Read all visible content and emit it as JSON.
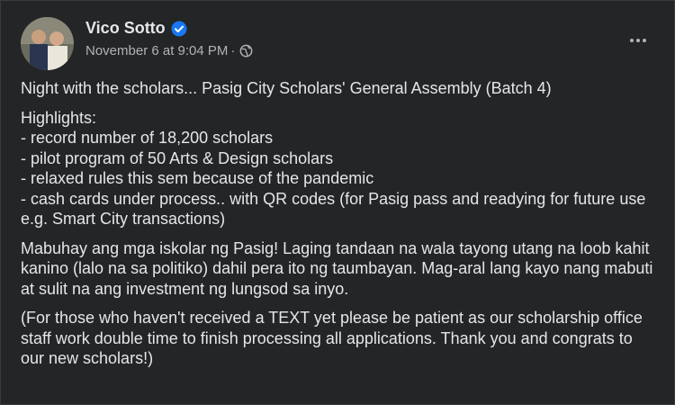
{
  "post": {
    "author": "Vico Sotto",
    "timestamp": "November 6 at 9:04 PM",
    "separator": "·",
    "verified_icon": "verified-badge-icon",
    "privacy_icon": "globe-icon",
    "more_icon": "more-options-icon",
    "colors": {
      "background": "#242526",
      "text": "#e4e6eb",
      "secondary_text": "#b0b3b8",
      "verified": "#1877f2"
    },
    "paragraphs": [
      "Night with the scholars... Pasig City Scholars' General Assembly (Batch 4)",
      "Highlights:\n- record number of 18,200 scholars\n- pilot program of 50 Arts & Design scholars\n- relaxed rules this sem because of the pandemic\n- cash cards under process.. with QR codes (for Pasig pass and readying for future use e.g. Smart City transactions)",
      "Mabuhay ang mga iskolar ng Pasig! Laging tandaan na wala tayong utang na loob kahit kanino (lalo na sa politiko) dahil pera ito ng taumbayan. Mag-aral lang kayo nang mabuti at sulit na ang investment ng lungsod sa inyo.",
      "(For those who haven't received a TEXT yet please be patient as our scholarship office staff work double time to finish processing all applications. Thank you and congrats to our new scholars!)"
    ]
  }
}
